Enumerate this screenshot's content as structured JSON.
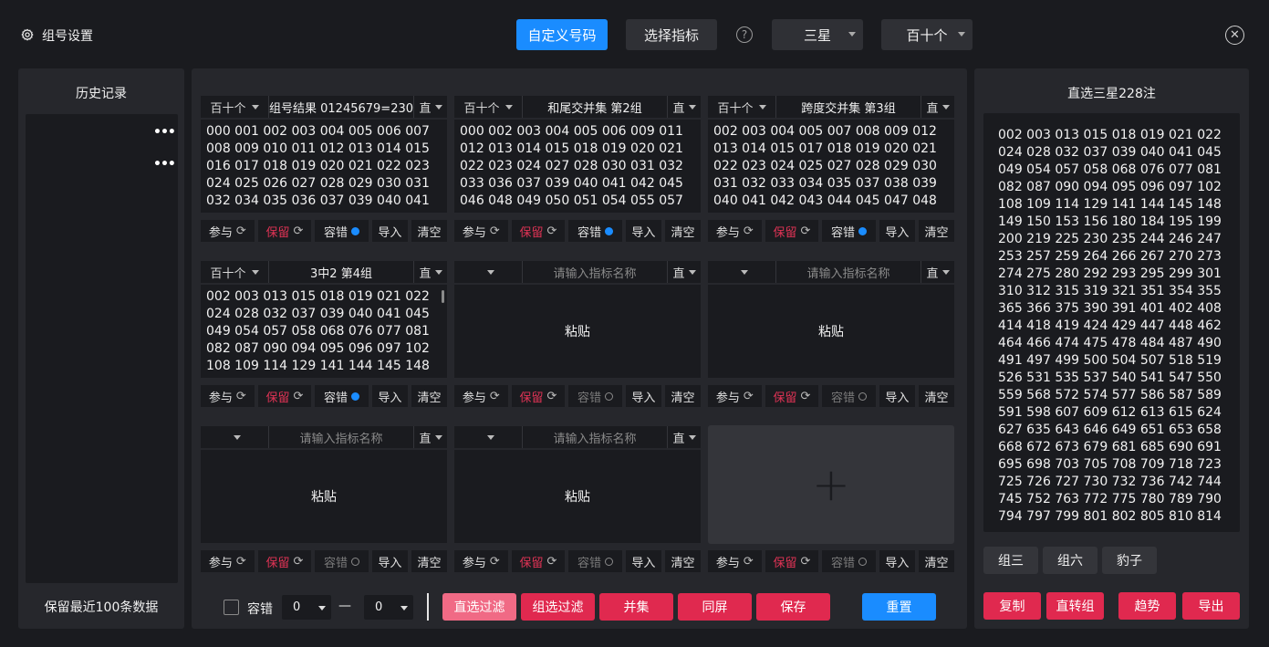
{
  "header": {
    "title": "组号设置",
    "custom_btn": "自定义号码",
    "indicator_btn": "选择指标",
    "help": "?",
    "mode_select": "三星",
    "position_select": "百十个"
  },
  "history": {
    "title": "历史记录",
    "footer": "保留最近100条数据"
  },
  "cards": [
    {
      "pos": "百十个",
      "name": "组号结果 01245679=230",
      "type": "直",
      "numbers": "000 001 002 003 004 005 006 007\n008 009 010 011 012 013 014 015\n016 017 018 019 020 021 022 023\n024 025 026 027 028 029 030 031\n032 034 035 036 037 039 040 041",
      "tol": true
    },
    {
      "pos": "百十个",
      "name": "和尾交并集 第2组",
      "type": "直",
      "numbers": "000 002 003 004 005 006 009 011\n012 013 014 015 018 019 020 021\n022 023 024 027 028 030 031 032\n033 036 037 039 040 041 042 045\n046 048 049 050 051 054 055 057",
      "tol": true
    },
    {
      "pos": "百十个",
      "name": "跨度交并集 第3组",
      "type": "直",
      "numbers": "002 003 004 005 007 008 009 012\n013 014 015 017 018 019 020 021\n022 023 024 025 027 028 029 030\n031 032 033 034 035 037 038 039\n040 041 042 043 044 045 047 048",
      "tol": true
    },
    {
      "pos": "百十个",
      "name": "3中2 第4组",
      "type": "直",
      "numbers": "002 003 013 015 018 019 021 022\n024 028 032 037 039 040 041 045\n049 054 057 058 068 076 077 081\n082 087 090 094 095 096 097 102\n108 109 114 129 141 144 145 148",
      "tol": true
    },
    {
      "pos": "",
      "name": "请输入指标名称",
      "type": "直",
      "paste": "粘贴",
      "tol": false
    },
    {
      "pos": "",
      "name": "请输入指标名称",
      "type": "直",
      "paste": "粘贴",
      "tol": false
    },
    {
      "pos": "",
      "name": "请输入指标名称",
      "type": "直",
      "paste": "粘贴",
      "tol": false
    },
    {
      "pos": "",
      "name": "请输入指标名称",
      "type": "直",
      "paste": "粘贴",
      "tol": false
    },
    {
      "pos": "",
      "name": "",
      "type": "",
      "paste": "",
      "tol": false
    }
  ],
  "tools": {
    "join": "参与",
    "keep": "保留",
    "tolerance": "容错",
    "import": "导入",
    "clear": "清空"
  },
  "bottom": {
    "tol_label": "容错",
    "min": "0",
    "dash": "—",
    "max": "0",
    "direct_filter": "直选过滤",
    "group_filter": "组选过滤",
    "union": "并集",
    "same_screen": "同屏",
    "save": "保存",
    "reset": "重置"
  },
  "result": {
    "title": "直选三星228注",
    "numbers": "002 003 013 015 018 019 021 022\n024 028 032 037 039 040 041 045\n049 054 057 058 068 076 077 081\n082 087 090 094 095 096 097 102\n108 109 114 129 141 144 145 148\n149 150 153 156 180 184 195 199\n200 219 225 230 235 244 246 247\n253 257 259 264 266 267 270 273\n274 275 280 292 293 295 299 301\n310 312 315 319 321 351 354 355\n365 366 375 390 391 401 402 408\n414 418 419 424 429 447 448 462\n464 466 474 475 478 484 487 490\n491 497 499 500 504 507 518 519\n526 531 535 537 540 541 547 550\n559 568 572 574 577 586 587 589\n591 598 607 609 612 613 615 624\n627 635 643 646 649 651 653 658\n668 672 673 679 681 685 690 691\n695 698 703 705 708 709 718 723\n725 726 727 730 732 736 742 744\n745 752 763 772 775 780 789 790\n794 797 799 801 802 805 810 814",
    "group3": "组三",
    "group6": "组六",
    "leopard": "豹子",
    "copy": "复制",
    "to_group": "直转组",
    "trend": "趋势",
    "export": "导出"
  }
}
